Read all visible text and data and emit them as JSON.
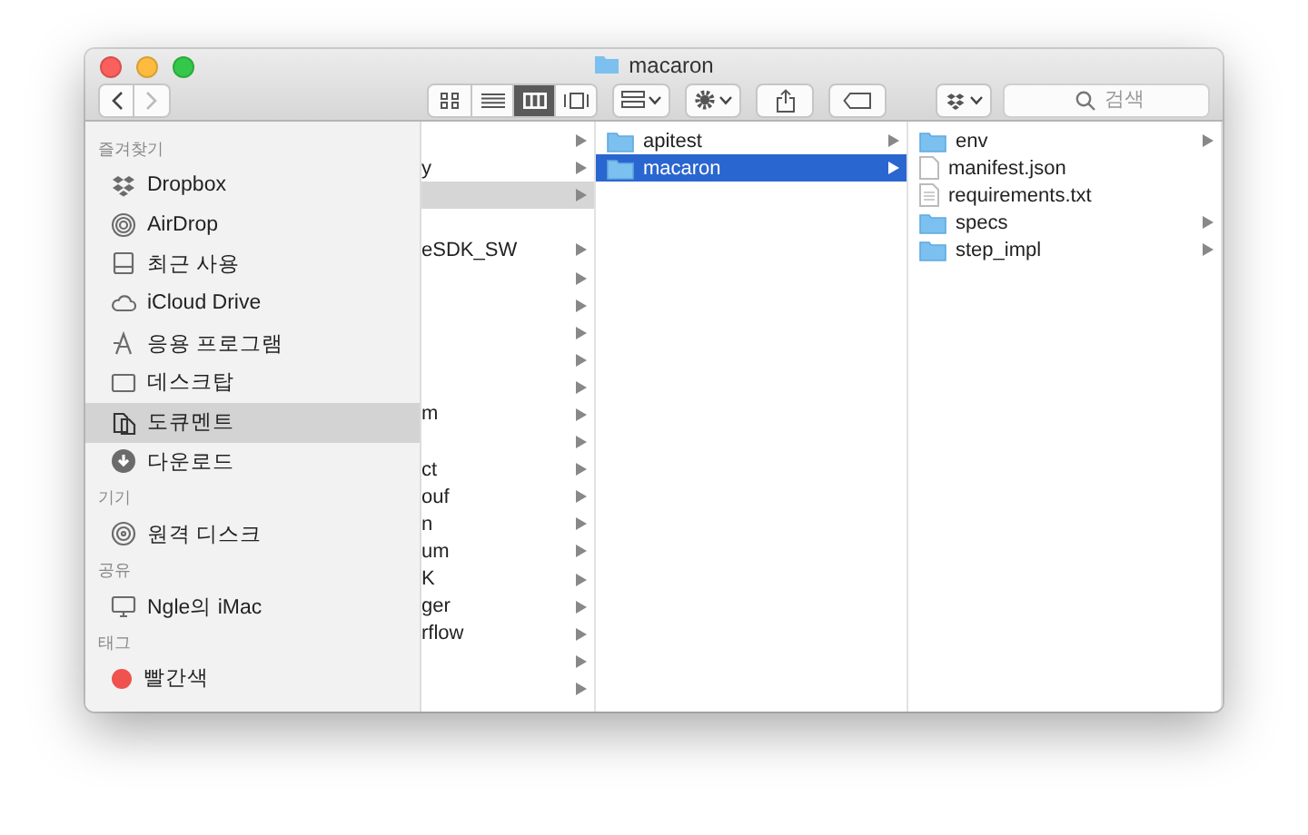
{
  "window": {
    "title": "macaron"
  },
  "toolbar": {
    "views": [
      {
        "kind": "icons",
        "selected": false
      },
      {
        "kind": "list",
        "selected": false
      },
      {
        "kind": "columns",
        "selected": true
      },
      {
        "kind": "gallery",
        "selected": false
      }
    ],
    "search": {
      "placeholder": "검색"
    }
  },
  "sidebar": {
    "sections": [
      {
        "heading": "즐겨찾기",
        "items": [
          {
            "label": "Dropbox",
            "kind": "dropbox",
            "selected": false
          },
          {
            "label": "AirDrop",
            "kind": "airdrop",
            "selected": false
          },
          {
            "label": "최근 사용",
            "kind": "recent",
            "selected": false
          },
          {
            "label": "iCloud Drive",
            "kind": "cloud",
            "selected": false
          },
          {
            "label": "응용 프로그램",
            "kind": "apps",
            "selected": false
          },
          {
            "label": "데스크탑",
            "kind": "desktop",
            "selected": false
          },
          {
            "label": "도큐멘트",
            "kind": "documents",
            "selected": true
          },
          {
            "label": "다운로드",
            "kind": "downloads",
            "selected": false
          }
        ]
      },
      {
        "heading": "기기",
        "items": [
          {
            "label": "원격 디스크",
            "kind": "disc",
            "selected": false
          }
        ]
      },
      {
        "heading": "공유",
        "items": [
          {
            "label": "Ngle의 iMac",
            "kind": "computer",
            "selected": false
          }
        ]
      },
      {
        "heading": "태그",
        "items": [
          {
            "label": "빨간색",
            "kind": "tag",
            "color": "#f0524f",
            "selected": false
          }
        ]
      }
    ]
  },
  "columns": [
    {
      "focused": false,
      "items": [
        {
          "kind": "folder",
          "selected": false
        },
        {
          "name": "y",
          "kind": "folder",
          "selected": false
        },
        {
          "kind": "folder",
          "selected": true
        },
        {
          "kind": "file",
          "selected": false
        },
        {
          "name": "eSDK_SW",
          "kind": "folder",
          "selected": false
        },
        {
          "kind": "folder",
          "selected": false
        },
        {
          "kind": "folder",
          "selected": false
        },
        {
          "kind": "folder",
          "selected": false
        },
        {
          "kind": "folder",
          "selected": false
        },
        {
          "kind": "folder",
          "selected": false
        },
        {
          "name": "m",
          "kind": "folder",
          "selected": false
        },
        {
          "kind": "folder",
          "selected": false
        },
        {
          "name": "ct",
          "kind": "folder",
          "selected": false
        },
        {
          "name": "ouf",
          "kind": "folder",
          "selected": false
        },
        {
          "name": "n",
          "kind": "folder",
          "selected": false
        },
        {
          "name": "um",
          "kind": "folder",
          "selected": false
        },
        {
          "name": "K",
          "kind": "folder",
          "selected": false
        },
        {
          "name": "ger",
          "kind": "folder",
          "selected": false
        },
        {
          "name": "rflow",
          "kind": "folder",
          "selected": false
        },
        {
          "kind": "folder",
          "selected": false
        },
        {
          "kind": "folder",
          "selected": false
        }
      ]
    },
    {
      "focused": true,
      "items": [
        {
          "name": "apitest",
          "kind": "folder",
          "selected": false
        },
        {
          "name": "macaron",
          "kind": "folder",
          "selected": true
        }
      ]
    },
    {
      "items": [
        {
          "name": "env",
          "kind": "folder",
          "selected": false
        },
        {
          "name": "manifest.json",
          "kind": "file",
          "selected": false
        },
        {
          "name": "requirements.txt",
          "kind": "text",
          "selected": false
        },
        {
          "name": "specs",
          "kind": "folder",
          "selected": false
        },
        {
          "name": "step_impl",
          "kind": "folder",
          "selected": false
        }
      ]
    }
  ]
}
